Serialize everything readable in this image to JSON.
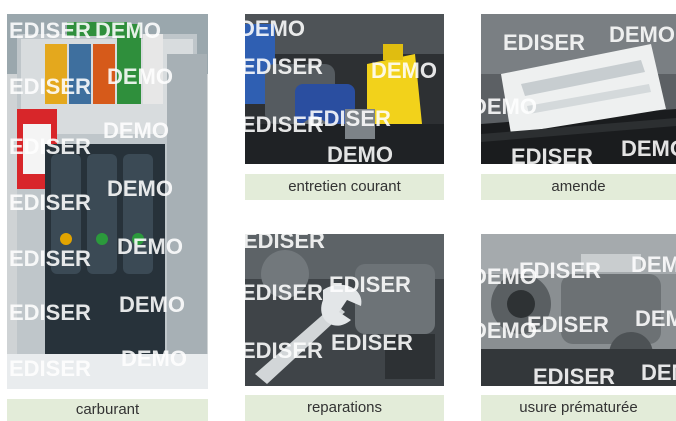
{
  "watermark": {
    "word_a": "EDISER",
    "word_b": "DEMO"
  },
  "tiles": [
    {
      "id": "fuel",
      "caption": "carburant",
      "image": "fuel-pump-photo"
    },
    {
      "id": "maint",
      "caption": "entretien courant",
      "image": "engine-oil-photo"
    },
    {
      "id": "fine",
      "caption": "amende",
      "image": "parking-ticket-photo"
    },
    {
      "id": "repair",
      "caption": "reparations",
      "image": "wrench-engine-photo"
    },
    {
      "id": "wear",
      "caption": "usure prématurée",
      "image": "worn-engine-photo"
    }
  ],
  "colors": {
    "caption_bg": "#e3ecd9",
    "caption_text": "#333333"
  }
}
